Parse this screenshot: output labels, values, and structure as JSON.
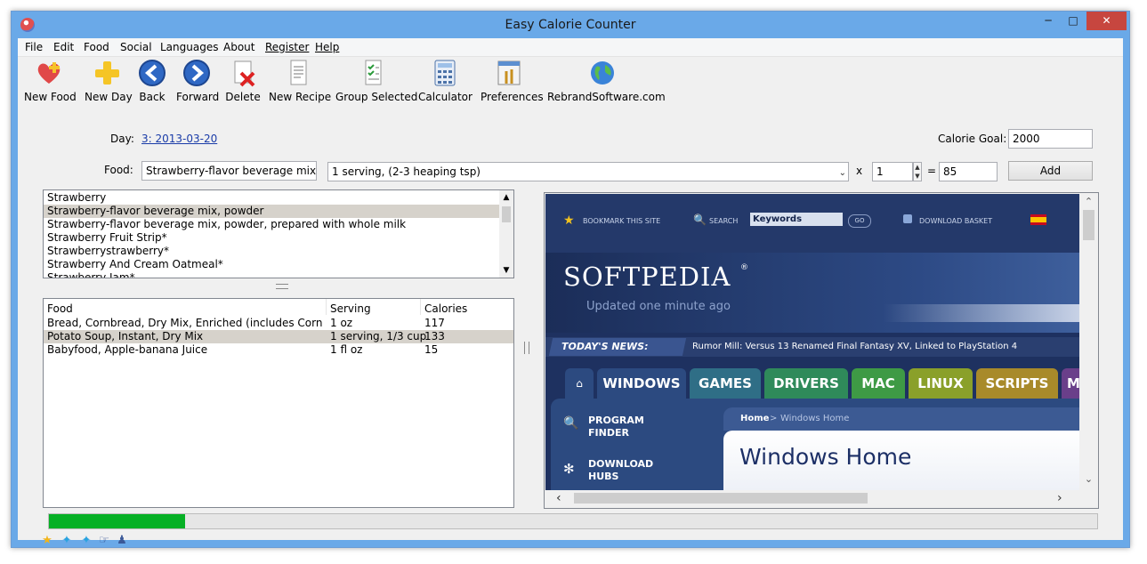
{
  "window": {
    "title": "Easy Calorie Counter"
  },
  "menu": [
    "File",
    "Edit",
    "Food",
    "Social",
    "Languages",
    "About",
    "Register",
    "Help"
  ],
  "toolbar": {
    "new_food": "New Food",
    "new_day": "New Day",
    "back": "Back",
    "forward": "Forward",
    "delete": "Delete",
    "new_recipe": "New Recipe",
    "group_selected": "Group Selected",
    "calculator": "Calculator",
    "preferences": "Preferences",
    "rebrand": "RebrandSoftware.com"
  },
  "day": {
    "label": "Day:",
    "value": "3: 2013-03-20"
  },
  "calorie_goal": {
    "label": "Calorie Goal:",
    "value": "2000"
  },
  "food": {
    "label": "Food:",
    "value": "Strawberry-flavor beverage mix, pov",
    "serving": "1 serving,  (2-3 heaping tsp)",
    "multiplier_sign": "x",
    "quantity": "1",
    "equals_sign": "=",
    "calories": "85",
    "add_label": "Add"
  },
  "search_results": [
    "Strawberry",
    "Strawberry-flavor beverage mix, powder",
    "Strawberry-flavor beverage mix, powder, prepared with whole milk",
    "Strawberry Fruit Strip*",
    "Strawberrystrawberry*",
    "Strawberry And Cream Oatmeal*",
    "Strawberry Jam*"
  ],
  "log_table": {
    "headers": {
      "food": "Food",
      "serving": "Serving",
      "calories": "Calories"
    },
    "rows": [
      {
        "food": "Bread, Cornbread, Dry Mix, Enriched (includes Corn Muffi...",
        "serving": "1 oz",
        "calories": "117"
      },
      {
        "food": "Potato Soup, Instant, Dry Mix",
        "serving": "1 serving, 1/3 cup",
        "calories": "133"
      },
      {
        "food": "Babyfood, Apple-banana Juice",
        "serving": "1 fl oz",
        "calories": "15"
      }
    ]
  },
  "web": {
    "bookmark": "BOOKMARK THIS SITE",
    "search_label": "SEARCH",
    "search_placeholder": "Keywords",
    "go": "GO",
    "download_basket": "DOWNLOAD BASKET",
    "logo": "SOFTPEDIA",
    "reg": "®",
    "updated": "Updated one minute ago",
    "news_label": "TODAY'S NEWS:",
    "news_text": "Rumor Mill: Versus 13 Renamed Final Fantasy XV, Linked to PlayStation 4",
    "tabs": [
      "WINDOWS",
      "GAMES",
      "DRIVERS",
      "MAC",
      "LINUX",
      "SCRIPTS",
      "M"
    ],
    "program_finder": [
      "PROGRAM",
      "FINDER"
    ],
    "download_hubs": [
      "DOWNLOAD",
      "HUBS"
    ],
    "breadcrumb_home": "Home",
    "breadcrumb_sep": ">",
    "breadcrumb_current": "Windows Home",
    "heading": "Windows Home"
  },
  "progress": {
    "fraction": 0.13
  },
  "colors": {
    "tab_windows": "#2c4a80",
    "tab_games": "#2f6e86",
    "tab_drivers": "#2f8a5a",
    "tab_mac": "#3e9a45",
    "tab_linux": "#8aa02a",
    "tab_scripts": "#a88a2a",
    "tab_more": "#6a3f8a"
  }
}
